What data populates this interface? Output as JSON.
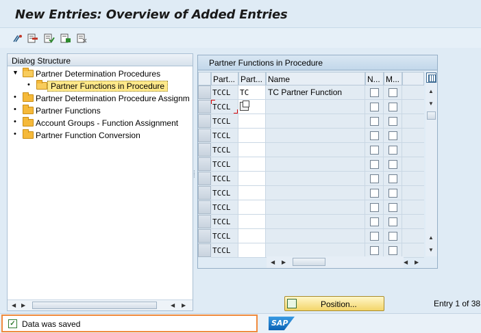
{
  "window": {
    "title": "New Entries: Overview of Added Entries"
  },
  "toolbar": {
    "icons": [
      "display-change-icon",
      "delete-icon",
      "select-all-icon",
      "select-block-icon",
      "deselect-all-icon"
    ]
  },
  "dialog_structure": {
    "header": "Dialog Structure",
    "items": [
      {
        "label": "Partner Determination Procedures",
        "level": 0,
        "expanded": true
      },
      {
        "label": "Partner Functions in Procedure",
        "level": 1,
        "selected": true
      },
      {
        "label": "Partner Determination Procedure Assignm",
        "level": 0
      },
      {
        "label": "Partner Functions",
        "level": 0
      },
      {
        "label": "Account Groups - Function Assignment",
        "level": 0
      },
      {
        "label": "Partner Function Conversion",
        "level": 0
      }
    ]
  },
  "table": {
    "title": "Partner Functions in Procedure",
    "columns": [
      "Part...",
      "Part...",
      "Name",
      "N...",
      "M..."
    ],
    "rows": [
      {
        "proc": "TCCL",
        "func": "TC",
        "name": "TC Partner Function",
        "n": false,
        "m": false
      },
      {
        "proc": "TCCL",
        "func": "",
        "name": "",
        "n": false,
        "m": false
      },
      {
        "proc": "TCCL",
        "func": "",
        "name": "",
        "n": false,
        "m": false
      },
      {
        "proc": "TCCL",
        "func": "",
        "name": "",
        "n": false,
        "m": false
      },
      {
        "proc": "TCCL",
        "func": "",
        "name": "",
        "n": false,
        "m": false
      },
      {
        "proc": "TCCL",
        "func": "",
        "name": "",
        "n": false,
        "m": false
      },
      {
        "proc": "TCCL",
        "func": "",
        "name": "",
        "n": false,
        "m": false
      },
      {
        "proc": "TCCL",
        "func": "",
        "name": "",
        "n": false,
        "m": false
      },
      {
        "proc": "TCCL",
        "func": "",
        "name": "",
        "n": false,
        "m": false
      },
      {
        "proc": "TCCL",
        "func": "",
        "name": "",
        "n": false,
        "m": false
      },
      {
        "proc": "TCCL",
        "func": "",
        "name": "",
        "n": false,
        "m": false
      },
      {
        "proc": "TCCL",
        "func": "",
        "name": "",
        "n": false,
        "m": false
      }
    ]
  },
  "position_button": {
    "label": "Position..."
  },
  "entry_info": "Entry 1 of 38",
  "status": {
    "message": "Data was saved",
    "type": "success"
  },
  "brand": {
    "logo_text": "SAP"
  }
}
